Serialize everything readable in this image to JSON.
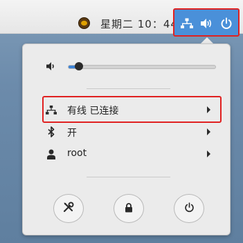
{
  "topbar": {
    "clock": "星期二 10：44",
    "weather_icon": "weather-icon",
    "status_icons": [
      "network-wired-icon",
      "volume-icon",
      "power-icon"
    ],
    "status_bg": "#4a90d9"
  },
  "menu": {
    "volume": {
      "icon": "volume-low-icon",
      "level": 0.07
    },
    "items": [
      {
        "label": "有线 已连接",
        "icon": "network-wired-icon"
      },
      {
        "label": "开",
        "icon": "bluetooth-icon"
      },
      {
        "label": "root",
        "icon": "user-icon"
      }
    ],
    "buttons": [
      {
        "icon": "settings-tools-icon"
      },
      {
        "icon": "lock-icon"
      },
      {
        "icon": "power-icon"
      }
    ]
  },
  "colors": {
    "accent": "#3d84d6",
    "highlight": "#e02020",
    "menu_bg": "#ebebeb"
  }
}
